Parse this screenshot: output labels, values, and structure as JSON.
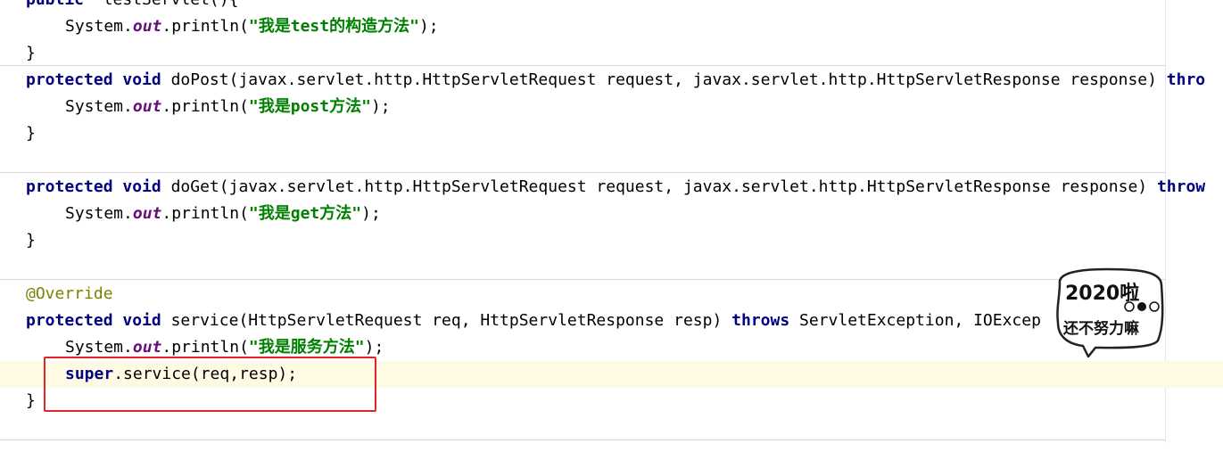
{
  "editor": {
    "lines": {
      "l0": {
        "kw": "public",
        "rest": "  testServlet(){"
      },
      "l1": {
        "pre": "System.",
        "field": "out",
        "mid": ".println(",
        "str": "\"我是test的构造方法\"",
        "post": ");"
      },
      "l2": {
        "text": "}"
      },
      "l3": {
        "kw1": "protected",
        "kw2": "void",
        "rest": " doPost(javax.servlet.http.HttpServletRequest request, javax.servlet.http.HttpServletResponse response) ",
        "throws": "thro"
      },
      "l4": {
        "pre": "System.",
        "field": "out",
        "mid": ".println(",
        "str": "\"我是post方法\"",
        "post": ");"
      },
      "l5": {
        "text": "}"
      },
      "l7": {
        "kw1": "protected",
        "kw2": "void",
        "rest": " doGet(javax.servlet.http.HttpServletRequest request, javax.servlet.http.HttpServletResponse response) ",
        "throws": "throw"
      },
      "l8": {
        "pre": "System.",
        "field": "out",
        "mid": ".println(",
        "str": "\"我是get方法\"",
        "post": ");"
      },
      "l9": {
        "text": "}"
      },
      "l11": {
        "anno": "@Override"
      },
      "l12": {
        "kw1": "protected",
        "kw2": "void",
        "mid": " service(HttpServletRequest req, HttpServletResponse resp) ",
        "throws": "throws",
        "rest": " ServletException, IOExcep"
      },
      "l13": {
        "pre": "System.",
        "field": "out",
        "mid": ".println(",
        "str": "\"我是服务方法\"",
        "post": ");"
      },
      "l14": {
        "kw": "super",
        "rest": ".service(req,resp);"
      },
      "l15": {
        "text": "}"
      }
    }
  },
  "sticker": {
    "text_top": "2020啦",
    "text_bottom": "还不努力嘛"
  },
  "colors": {
    "keyword": "#000080",
    "string": "#008000",
    "field": "#660e7a",
    "annotation": "#808000",
    "highlight": "#fffae3",
    "red_box": "#e0262b"
  }
}
